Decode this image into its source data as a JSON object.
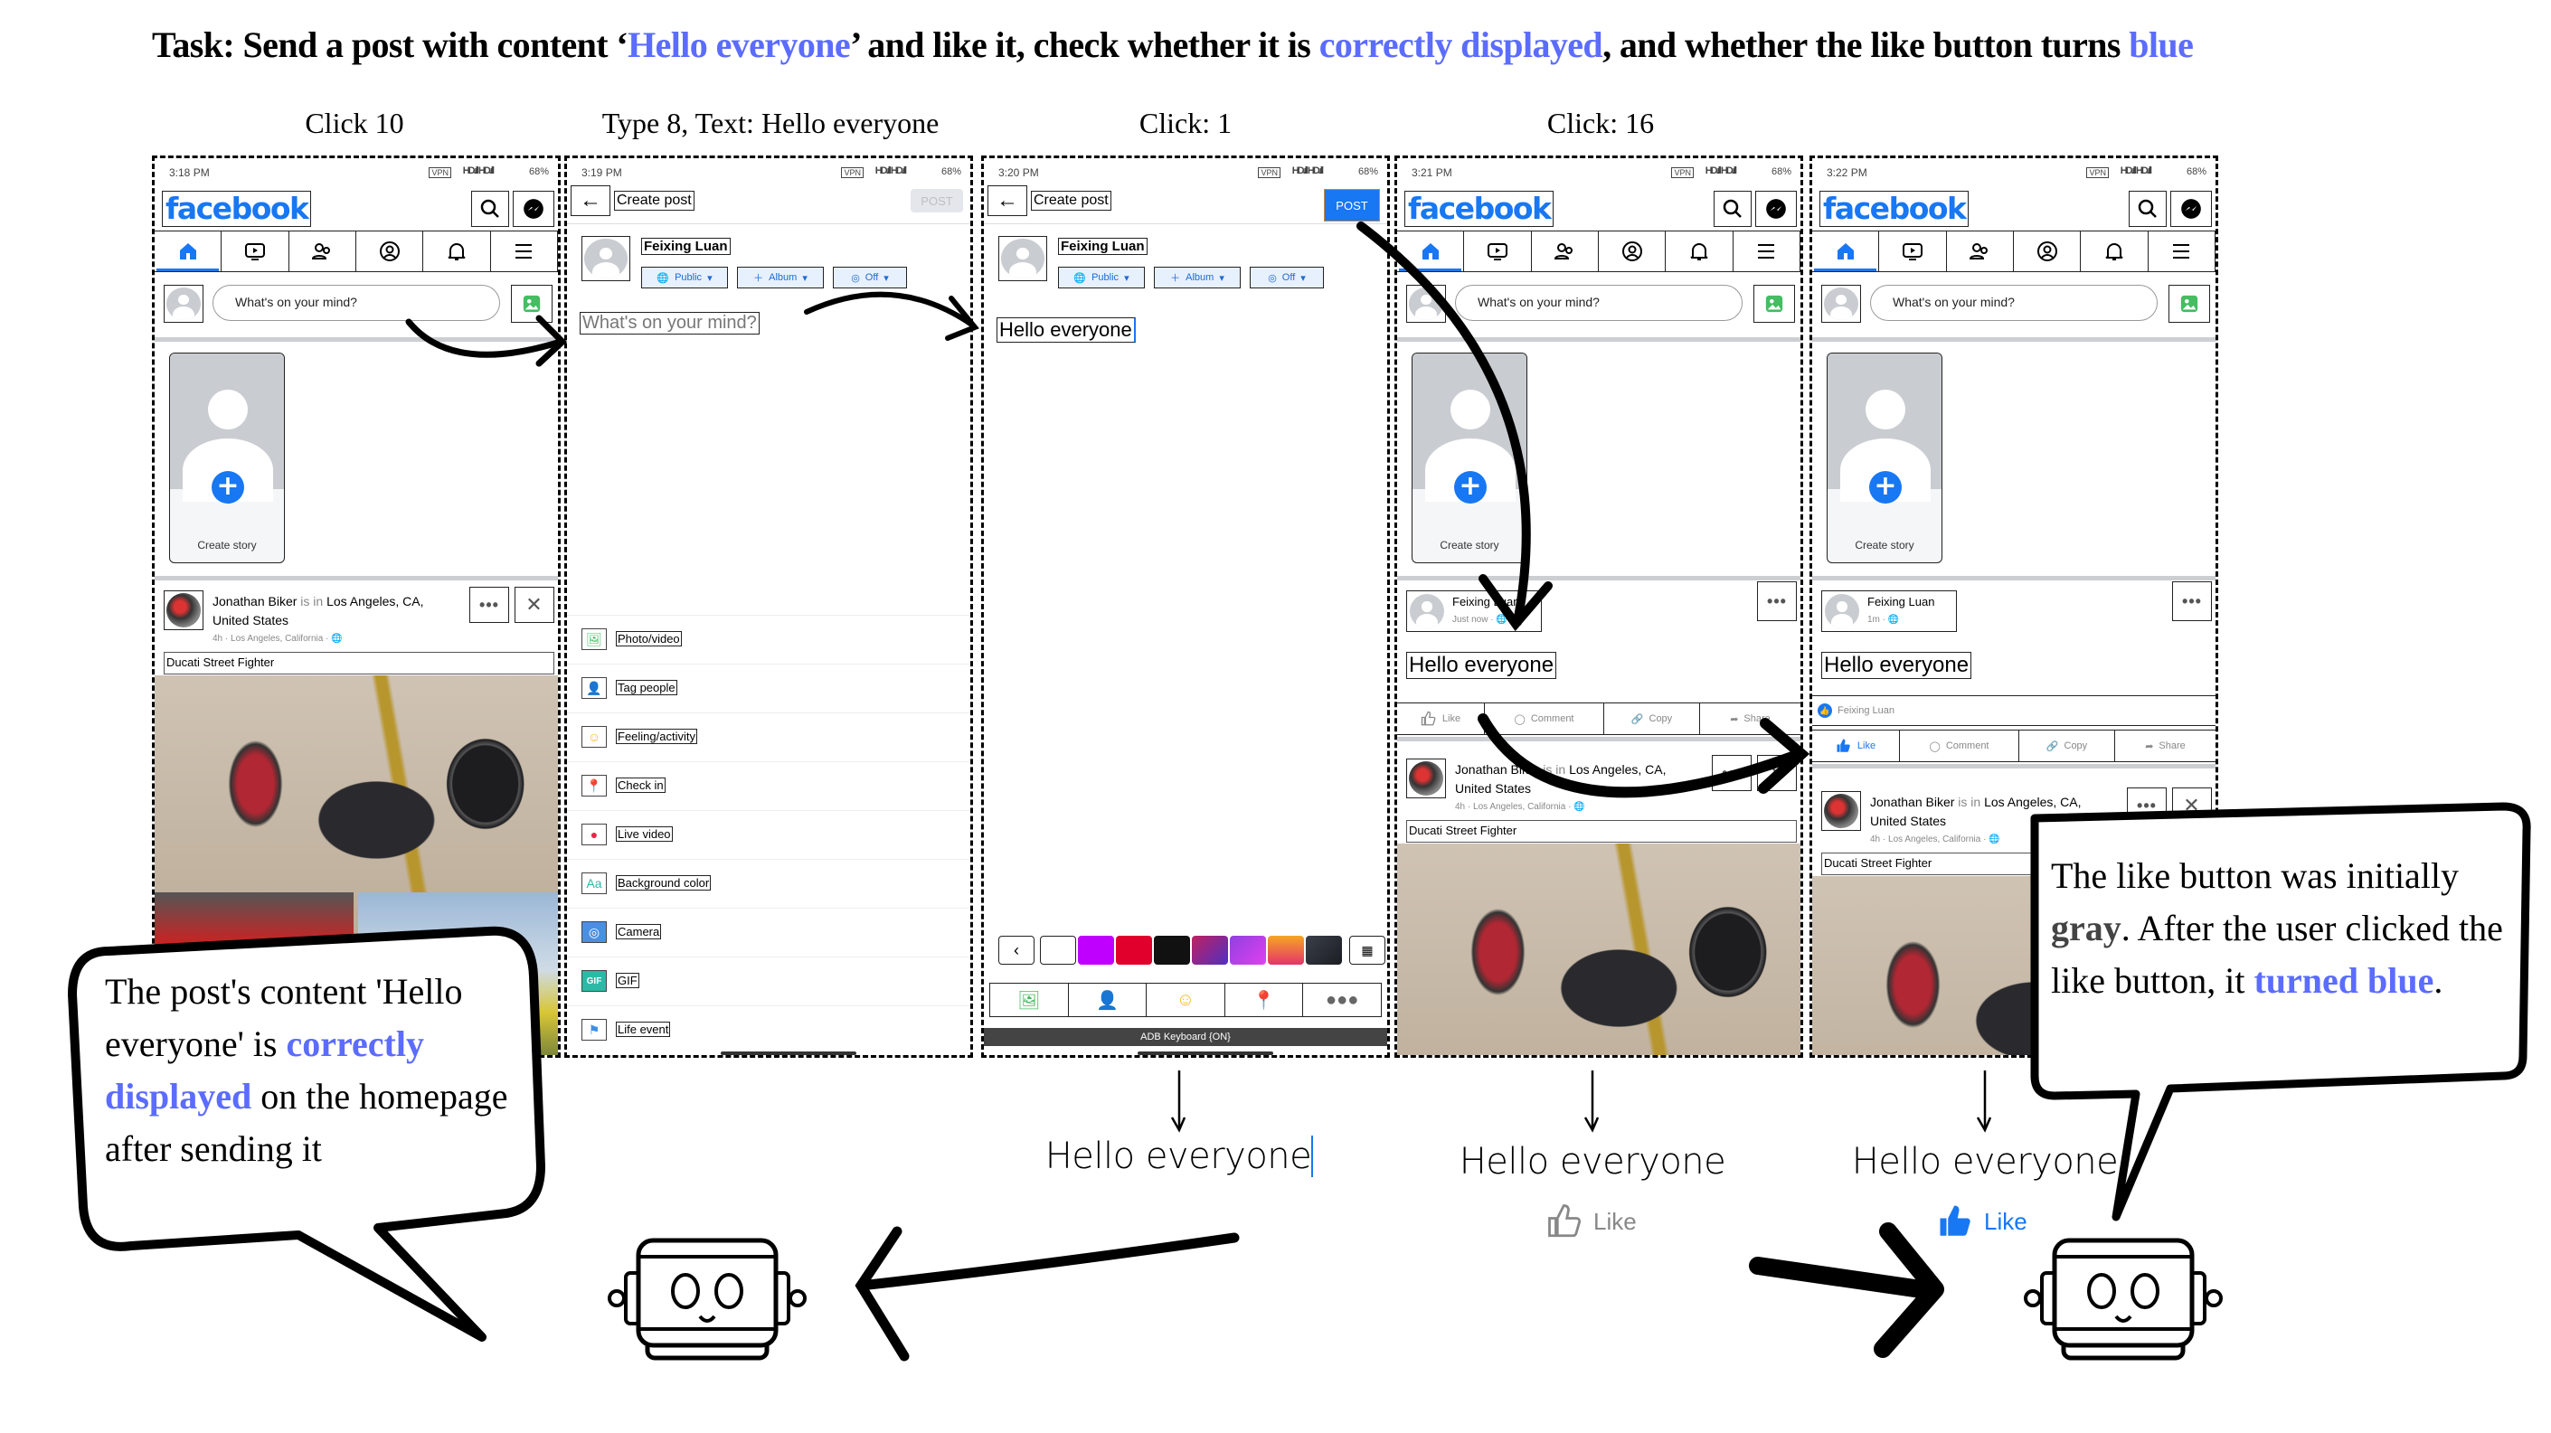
{
  "task": {
    "prefix": "Task: Send a post with content ‘",
    "hl1": "Hello everyone",
    "mid1": "’ and like it, check whether it is ",
    "hl2": "correctly displayed",
    "mid2": ", and whether the like button turns ",
    "hl3": "blue"
  },
  "steps": [
    "Click 10",
    "Type 8, Text: Hello everyone",
    "Click: 1",
    "Click: 16"
  ],
  "colors": {
    "highlight": "#5b6cff",
    "facebook_blue": "#1877f2",
    "like_gray": "#888888"
  },
  "status": {
    "vpn": "VPN",
    "signal": "HD.ıll HD.ıll",
    "battery": "68%"
  },
  "phones": [
    {
      "time": "3:18 PM"
    },
    {
      "time": "3:19 PM"
    },
    {
      "time": "3:20 PM"
    },
    {
      "time": "3:21 PM"
    },
    {
      "time": "3:22 PM"
    }
  ],
  "home": {
    "logo": "facebook",
    "composer_placeholder": "What's on your mind?",
    "story_label": "Create story",
    "nav_icons": [
      "home-icon",
      "video-icon",
      "friends-icon",
      "profile-icon",
      "bell-icon",
      "menu-icon"
    ]
  },
  "jonathan": {
    "author": "Jonathan Biker",
    "is_in": " is in ",
    "location": "Los Angeles, CA, United States",
    "time": "4h",
    "dot": "·",
    "place": "Los Angeles, California",
    "caption": "Ducati Street Fighter",
    "more": "•••",
    "close": "✕"
  },
  "create": {
    "title": "Create post",
    "post_label": "POST",
    "user": "Feixing Luan",
    "chips": [
      "Public",
      "Album",
      "Off"
    ],
    "placeholder": "What's on your mind?",
    "typed_text": "Hello everyone",
    "options": [
      "Photo/video",
      "Tag people",
      "Feeling/activity",
      "Check in",
      "Live video",
      "Background color",
      "Camera",
      "GIF",
      "Life event"
    ],
    "option_icons": [
      "🖼",
      "👤",
      "☺",
      "📍",
      "●",
      "Aa",
      "◎",
      "GIF",
      "⚑"
    ],
    "swatches": [
      "#ffffff",
      "#c000ff",
      "#e0002b",
      "#111111",
      "linear-gradient(135deg,#c02060,#5030c0)",
      "linear-gradient(135deg,#9040e0,#e040f0)",
      "linear-gradient(180deg,#f5a623,#e5336a)",
      "linear-gradient(135deg,#3a3f4a,#1b1d22)"
    ],
    "keyboard": "ADB Keyboard {ON}"
  },
  "own_post": {
    "author": "Feixing Luan",
    "time_before": "Just now",
    "time_after": "1m",
    "text": "Hello everyone",
    "liked_by": "Feixing Luan"
  },
  "actions": [
    "Like",
    "Comment",
    "Copy",
    "Share"
  ],
  "bubble_left": {
    "t1": "The post's content 'Hello everyone' is ",
    "hl": "correctly displayed",
    "t2": " on the homepage after sending it"
  },
  "bubble_right": {
    "t1": "The like button was initially ",
    "gray": "gray",
    "t2": ". After the user clicked the like button, it ",
    "hl": "turned blue",
    "t3": "."
  },
  "outcomes": [
    {
      "text": "Hello everyone"
    },
    {
      "text": "Hello everyone",
      "like": "Like",
      "liked": false
    },
    {
      "text": "Hello everyone",
      "like": "Like",
      "liked": true
    }
  ]
}
